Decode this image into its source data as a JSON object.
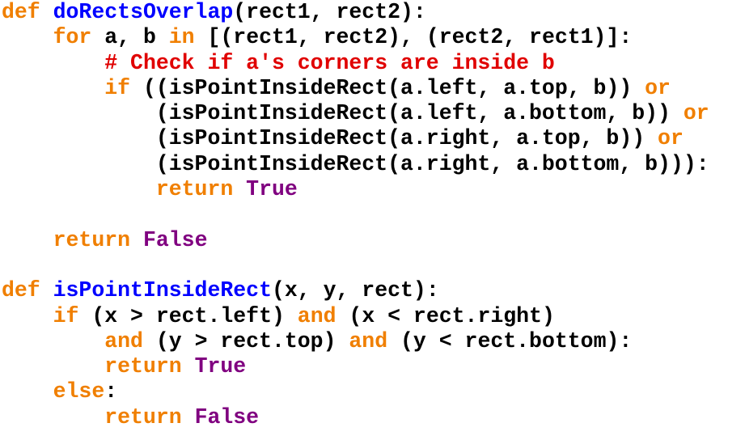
{
  "colors": {
    "keyword": "#f07f00",
    "function_name": "#0000ff",
    "comment": "#e00000",
    "constant": "#800080",
    "text": "#000000",
    "background": "#ffffff"
  },
  "lines": [
    [
      [
        "kw",
        "def"
      ],
      [
        "plain",
        " "
      ],
      [
        "fn",
        "doRectsOverlap"
      ],
      [
        "plain",
        "(rect1, rect2):"
      ]
    ],
    [
      [
        "plain",
        "    "
      ],
      [
        "kw",
        "for"
      ],
      [
        "plain",
        " a, b "
      ],
      [
        "kw",
        "in"
      ],
      [
        "plain",
        " [(rect1, rect2), (rect2, rect1)]:"
      ]
    ],
    [
      [
        "plain",
        "        "
      ],
      [
        "cmt",
        "# Check if a's corners are inside b"
      ]
    ],
    [
      [
        "plain",
        "        "
      ],
      [
        "kw",
        "if"
      ],
      [
        "plain",
        " ((isPointInsideRect(a.left, a.top, b)) "
      ],
      [
        "kw",
        "or"
      ]
    ],
    [
      [
        "plain",
        "            (isPointInsideRect(a.left, a.bottom, b)) "
      ],
      [
        "kw",
        "or"
      ]
    ],
    [
      [
        "plain",
        "            (isPointInsideRect(a.right, a.top, b)) "
      ],
      [
        "kw",
        "or"
      ]
    ],
    [
      [
        "plain",
        "            (isPointInsideRect(a.right, a.bottom, b))):"
      ]
    ],
    [
      [
        "plain",
        "            "
      ],
      [
        "kw",
        "return"
      ],
      [
        "plain",
        " "
      ],
      [
        "const",
        "True"
      ]
    ],
    [],
    [
      [
        "plain",
        "    "
      ],
      [
        "kw",
        "return"
      ],
      [
        "plain",
        " "
      ],
      [
        "const",
        "False"
      ]
    ],
    [],
    [
      [
        "kw",
        "def"
      ],
      [
        "plain",
        " "
      ],
      [
        "fn",
        "isPointInsideRect"
      ],
      [
        "plain",
        "(x, y, rect):"
      ]
    ],
    [
      [
        "plain",
        "    "
      ],
      [
        "kw",
        "if"
      ],
      [
        "plain",
        " (x > rect.left) "
      ],
      [
        "kw",
        "and"
      ],
      [
        "plain",
        " (x < rect.right)"
      ]
    ],
    [
      [
        "plain",
        "        "
      ],
      [
        "kw",
        "and"
      ],
      [
        "plain",
        " (y > rect.top) "
      ],
      [
        "kw",
        "and"
      ],
      [
        "plain",
        " (y < rect.bottom):"
      ]
    ],
    [
      [
        "plain",
        "        "
      ],
      [
        "kw",
        "return"
      ],
      [
        "plain",
        " "
      ],
      [
        "const",
        "True"
      ]
    ],
    [
      [
        "plain",
        "    "
      ],
      [
        "kw",
        "else"
      ],
      [
        "plain",
        ":"
      ]
    ],
    [
      [
        "plain",
        "        "
      ],
      [
        "kw",
        "return"
      ],
      [
        "plain",
        " "
      ],
      [
        "const",
        "False"
      ]
    ]
  ]
}
